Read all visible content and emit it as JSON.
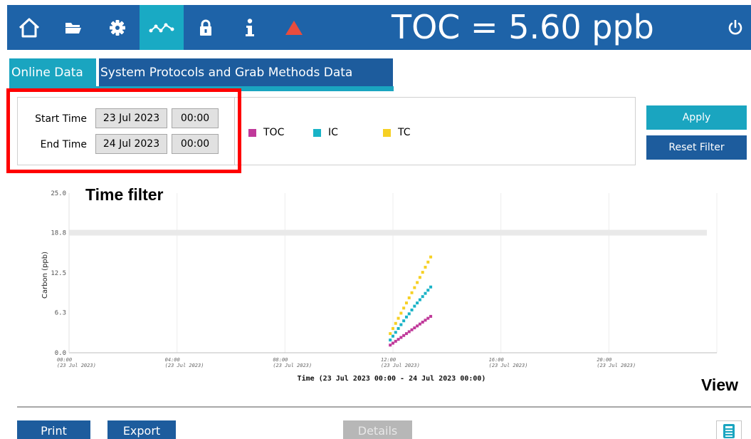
{
  "nav": {
    "items": [
      {
        "icon": "home-icon",
        "active": false
      },
      {
        "icon": "folder-icon",
        "active": false
      },
      {
        "icon": "gear-icon",
        "active": false
      },
      {
        "icon": "data-trend-icon",
        "active": true
      },
      {
        "icon": "lock-icon",
        "active": false
      },
      {
        "icon": "info-icon",
        "active": false
      },
      {
        "icon": "warning-triangle-icon",
        "active": false
      }
    ],
    "toc_readout": "TOC = 5.60 ppb",
    "power_icon": "power-icon"
  },
  "tabs": [
    {
      "label": "Online Data",
      "active": true
    },
    {
      "label": "System Protocols and Grab Methods Data",
      "active": false
    }
  ],
  "filter": {
    "start_label": "Start Time",
    "start_date": "23 Jul 2023",
    "start_time": "00:00",
    "end_label": "End Time",
    "end_date": "24 Jul 2023",
    "end_time": "00:00"
  },
  "legend": [
    {
      "label": "TOC",
      "color": "#c0399a"
    },
    {
      "label": "IC",
      "color": "#19b3c7"
    },
    {
      "label": "TC",
      "color": "#f6d024"
    }
  ],
  "buttons": {
    "apply": "Apply",
    "reset": "Reset Filter",
    "print": "Print",
    "export": "Export",
    "details": "Details"
  },
  "annotations": {
    "time_filter": "Time filter",
    "view": "View"
  },
  "colors": {
    "nav_bg": "#1e63a8",
    "accent": "#1aa5c0",
    "tab_inactive": "#1d5c9d",
    "warning": "#e84c3d",
    "highlight": "#ff0000"
  },
  "chart_data": {
    "type": "scatter",
    "xlabel": "Time (23 Jul 2023 00:00 - 24 Jul 2023 00:00)",
    "ylabel": "Carbon (ppb)",
    "ylim": [
      0,
      25.0
    ],
    "y_ticks": [
      "0.0",
      "6.3",
      "12.5",
      "18.8",
      "25.0"
    ],
    "x_ticks": [
      {
        "time": "00:00",
        "date": "(23 Jul 2023)"
      },
      {
        "time": "04:00",
        "date": "(23 Jul 2023)"
      },
      {
        "time": "08:00",
        "date": "(23 Jul 2023)"
      },
      {
        "time": "12:00",
        "date": "(23 Jul 2023)"
      },
      {
        "time": "16:00",
        "date": "(23 Jul 2023)"
      },
      {
        "time": "20:00",
        "date": "(23 Jul 2023)"
      }
    ],
    "xlim_hours": [
      0,
      24
    ],
    "reference_line": 18.8,
    "series": [
      {
        "name": "TOC",
        "color": "#c0399a",
        "x": [
          11.9,
          12.0,
          12.1,
          12.2,
          12.3,
          12.4,
          12.5,
          12.6,
          12.7,
          12.8,
          12.9,
          13.0,
          13.1,
          13.2,
          13.3,
          13.4
        ],
        "y": [
          1.2,
          1.5,
          1.8,
          2.1,
          2.4,
          2.7,
          3.0,
          3.3,
          3.6,
          3.9,
          4.2,
          4.5,
          4.8,
          5.1,
          5.4,
          5.7
        ]
      },
      {
        "name": "IC",
        "color": "#19b3c7",
        "x": [
          11.9,
          12.0,
          12.1,
          12.2,
          12.3,
          12.4,
          12.5,
          12.6,
          12.7,
          12.8,
          12.9,
          13.0,
          13.1,
          13.2,
          13.3,
          13.4
        ],
        "y": [
          2.0,
          2.6,
          3.2,
          3.8,
          4.4,
          5.0,
          5.6,
          6.1,
          6.7,
          7.3,
          7.8,
          8.3,
          8.8,
          9.3,
          9.8,
          10.3
        ]
      },
      {
        "name": "TC",
        "color": "#f6d024",
        "x": [
          11.9,
          12.0,
          12.1,
          12.2,
          12.3,
          12.4,
          12.5,
          12.6,
          12.7,
          12.8,
          12.9,
          13.0,
          13.1,
          13.2,
          13.3,
          13.4
        ],
        "y": [
          3.0,
          3.8,
          4.6,
          5.4,
          6.2,
          7.0,
          7.8,
          8.6,
          9.4,
          10.2,
          11.0,
          11.8,
          12.6,
          13.4,
          14.2,
          15.0
        ]
      }
    ]
  }
}
